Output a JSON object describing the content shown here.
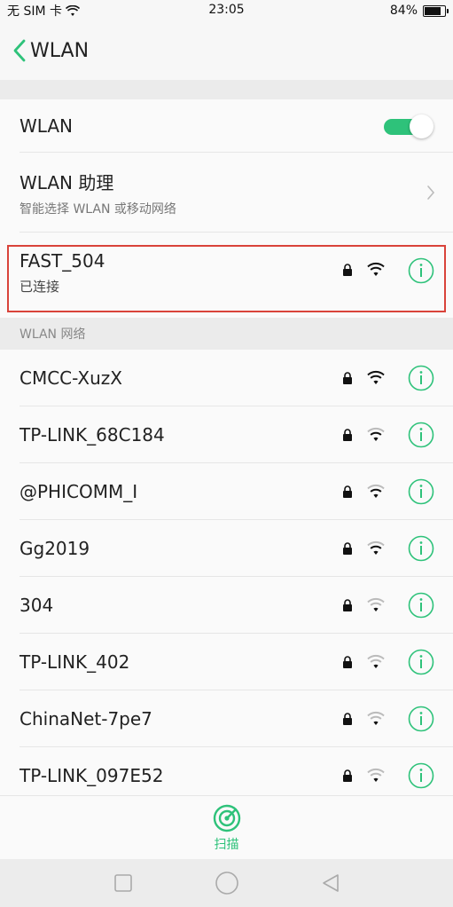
{
  "status_bar": {
    "carrier": "无 SIM 卡",
    "time": "23:05",
    "battery": "84%",
    "battery_level": 0.84
  },
  "header": {
    "title": "WLAN"
  },
  "wlan_toggle": {
    "label": "WLAN",
    "enabled": true
  },
  "assistant": {
    "title": "WLAN 助理",
    "subtitle": "智能选择 WLAN 或移动网络"
  },
  "connected": {
    "name": "FAST_504",
    "status": "已连接"
  },
  "section": {
    "title": "WLAN 网络"
  },
  "networks": [
    {
      "name": "CMCC-XuzX",
      "strength": 3
    },
    {
      "name": "TP-LINK_68C184",
      "strength": 2
    },
    {
      "name": "@PHICOMM_I",
      "strength": 2
    },
    {
      "name": "Gg2019",
      "strength": 2
    },
    {
      "name": "304",
      "strength": 1
    },
    {
      "name": "TP-LINK_402",
      "strength": 1
    },
    {
      "name": "ChinaNet-7pe7",
      "strength": 1
    },
    {
      "name": "TP-LINK_097E52",
      "strength": 1
    }
  ],
  "bottom": {
    "scan_label": "扫描"
  },
  "colors": {
    "accent": "#2ec27a",
    "highlight_border": "#d9433a"
  },
  "icons": {
    "back": "chevron-left-icon",
    "lock": "lock-icon",
    "wifi": "wifi-icon",
    "info": "info-icon",
    "scan": "radar-icon"
  }
}
